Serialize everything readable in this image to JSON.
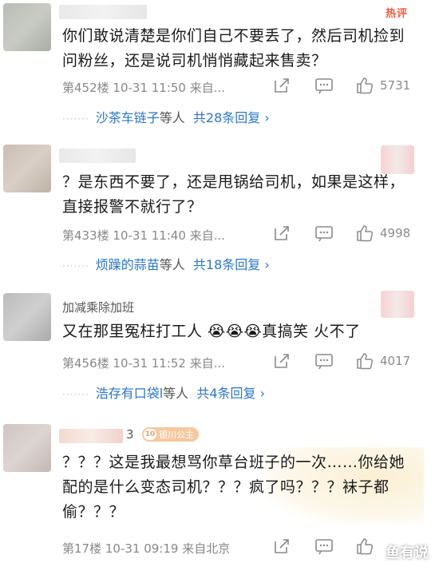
{
  "comments": [
    {
      "username": "",
      "hot_label": "热评",
      "content": "你们敢说清楚是你们自己不要丢了，然后司机捡到问粉丝，还是说司机悄悄藏起来售卖？",
      "meta": "第452楼  10-31 11:50  来自...",
      "likes": "5731",
      "replies": {
        "who": "沙茶车链子",
        "mid": "等人",
        "count": "共28条回复 ›"
      }
    },
    {
      "username": "",
      "content": "？是东西不要了，还是甩锅给司机，如果是这样，直接报警不就行了？",
      "meta": "第433楼  10-31 11:40  来自...",
      "likes": "4998",
      "replies": {
        "who": "烦躁的蒜苗",
        "mid": "等人",
        "count": "共18条回复 ›"
      }
    },
    {
      "username": "加减乘除加班",
      "content": "又在那里冤枉打工人  😭😭😭真搞笑   火不了",
      "meta": "第456楼  10-31 11:52  来自...",
      "likes": "4017",
      "replies": {
        "who": "浩存有口袋l",
        "mid": "等人",
        "count": "共4条回复 ›"
      }
    },
    {
      "username": "3",
      "badge_level": "10",
      "badge_text": "银川公主",
      "content": "？？？这是我最想骂你草台班子的一次……你给她配的是什么变态司机？？？疯了吗？？？袜子都偷？？？",
      "meta": "第17楼  10-31 09:19  来自北京",
      "likes": "",
      "replies": null
    }
  ],
  "watermark": "鱼有说",
  "colors": {
    "link": "#2b75c6",
    "meta": "#888888",
    "hot": "#f45b3f"
  }
}
